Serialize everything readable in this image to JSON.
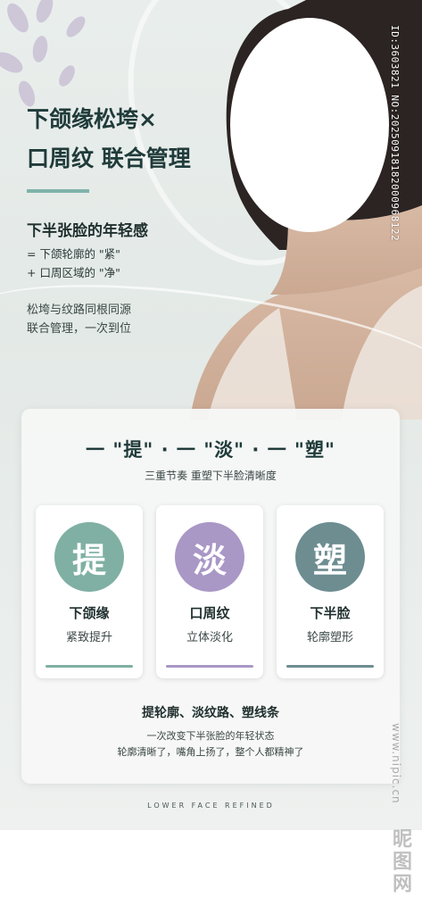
{
  "headline": {
    "line1": "下颌缘松垮×",
    "line2": "口周纹 联合管理"
  },
  "intro": {
    "title": "下半张脸的年轻感",
    "lines": [
      "= 下颌轮廓的 \"紧\"",
      "+ 口周区域的 \"净\""
    ],
    "notes": [
      "松垮与纹路同根同源",
      "联合管理，一次到位"
    ]
  },
  "card": {
    "title": "一 \"提\" · 一 \"淡\" · 一 \"塑\"",
    "subtitle": "三重节奏 重塑下半脸清晰度",
    "items": [
      {
        "glyph": "提",
        "name": "下颌缘",
        "desc": "紧致提升",
        "color": "#7fb0a3"
      },
      {
        "glyph": "淡",
        "name": "口周纹",
        "desc": "立体淡化",
        "color": "#a997c6"
      },
      {
        "glyph": "塑",
        "name": "下半脸",
        "desc": "轮廓塑形",
        "color": "#6d8d91"
      }
    ],
    "summary_title": "提轮廓、淡纹路、塑线条",
    "summary_lines": [
      "一次改变下半张脸的年轻状态",
      "轮廓清晰了，嘴角上扬了，整个人都精神了"
    ]
  },
  "footer": "LOWER FACE REFINED",
  "watermarks": {
    "id": "ID:3603821 NO:20250918182000968122",
    "site": "www.nipic.cn",
    "brand": "昵图网"
  }
}
